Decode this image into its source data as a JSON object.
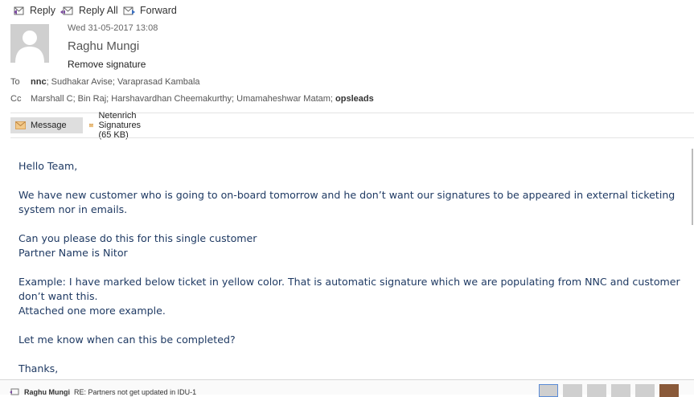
{
  "toolbar": {
    "reply": "Reply",
    "reply_all": "Reply All",
    "forward": "Forward"
  },
  "message": {
    "date": "Wed 31-05-2017 13:08",
    "sender": "Raghu Mungi",
    "subject": "Remove signature",
    "to_label": "To",
    "to_bold": "nnc",
    "to_rest": "; Sudhakar Avise; Varaprasad Kambala",
    "cc_label": "Cc",
    "cc_rest": "Marshall C; Bin Raj; Harshavardhan Cheemakurthy; Umamaheshwar Matam; ",
    "cc_bold": "opsleads"
  },
  "attachments": [
    {
      "label": "Message"
    },
    {
      "label": "Netenrich Signatures (65 KB)"
    }
  ],
  "body": [
    "Hello Team,",
    "We have new customer who is going to on-board tomorrow and he don’t want our signatures to be appeared in external ticketing system nor in emails.",
    "Can you please do this for this single customer",
    "Partner Name is Nitor",
    "Example: I have marked below ticket in yellow color. That is automatic signature which we are populating from NNC and customer don’t want this.",
    "Attached one more example.",
    "Let me know when can this be completed?",
    "Thanks,"
  ],
  "bottom_bar": {
    "sender": "Raghu Mungi",
    "subject": "RE: Partners not get updated in IDU-1"
  }
}
